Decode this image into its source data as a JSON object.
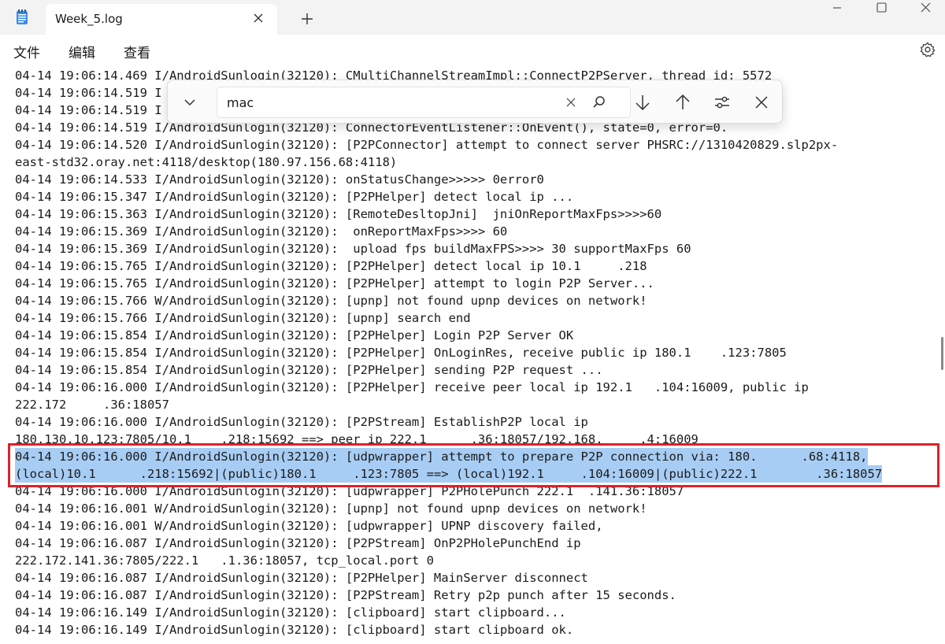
{
  "window": {
    "tab_title": "Week_5.log"
  },
  "menu": {
    "file": "文件",
    "edit": "编辑",
    "view": "查看"
  },
  "find": {
    "query": "mac"
  },
  "log_lines": [
    "04-14 19:06:14.469 I/AndroidSunlogin(32120): CMultiChannelStreamImpl::ConnectP2PServer, thread id: 5572",
    "04-14 19:06:14.519 I",
    "04-14 19:06:14.519 I",
    "04-14 19:06:14.519 I/AndroidSunlogin(32120): ConnectorEventListener::OnEvent(), state=0, error=0.",
    "04-14 19:06:14.520 I/AndroidSunlogin(32120): [P2PConnector] attempt to connect server PHSRC://1310420829.slp2px-",
    "east-std32.oray.net:4118/desktop(180.97.156.68:4118)",
    "04-14 19:06:14.533 I/AndroidSunlogin(32120): onStatusChange>>>>> 0error0",
    "04-14 19:06:15.347 I/AndroidSunlogin(32120): [P2PHelper] detect local ip ...",
    "04-14 19:06:15.363 I/AndroidSunlogin(32120): [RemoteDesltopJni]  jniOnReportMaxFps>>>>60",
    "04-14 19:06:15.369 I/AndroidSunlogin(32120):  onReportMaxFps>>>> 60",
    "04-14 19:06:15.369 I/AndroidSunlogin(32120):  upload fps buildMaxFPS>>>> 30 supportMaxFps 60",
    "04-14 19:06:15.765 I/AndroidSunlogin(32120): [P2PHelper] detect local ip 10.1     .218",
    "04-14 19:06:15.765 I/AndroidSunlogin(32120): [P2PHelper] attempt to login P2P Server...",
    "04-14 19:06:15.766 W/AndroidSunlogin(32120): [upnp] not found upnp devices on network!",
    "04-14 19:06:15.766 I/AndroidSunlogin(32120): [upnp] search end",
    "04-14 19:06:15.854 I/AndroidSunlogin(32120): [P2PHelper] Login P2P Server OK",
    "04-14 19:06:15.854 I/AndroidSunlogin(32120): [P2PHelper] OnLoginRes, receive public ip 180.1    .123:7805",
    "04-14 19:06:15.854 I/AndroidSunlogin(32120): [P2PHelper] sending P2P request ...",
    "04-14 19:06:16.000 I/AndroidSunlogin(32120): [P2PHelper] receive peer local ip 192.1   .104:16009, public ip",
    "222.172     .36:18057",
    "04-14 19:06:16.000 I/AndroidSunlogin(32120): [P2PStream] EstablishP2P local ip",
    "180.130.10.123:7805/10.1    .218:15692 ==> peer ip 222.1      .36:18057/192.168.     .4:16009",
    "04-14 19:06:16.000 I/AndroidSunlogin(32120): [udpwrapper] attempt to prepare P2P connection via: 180.      .68:4118,",
    "(local)10.1      .218:15692|(public)180.1     .123:7805 ==> (local)192.1     .104:16009|(public)222.1        .36:18057",
    "04-14 19:06:16.000 I/AndroidSunlogin(32120): [udpwrapper] P2PHolePunch 222.1  .141.36:18057",
    "04-14 19:06:16.001 W/AndroidSunlogin(32120): [upnp] not found upnp devices on network!",
    "04-14 19:06:16.001 W/AndroidSunlogin(32120): [udpwrapper] UPNP discovery failed,",
    "04-14 19:06:16.087 I/AndroidSunlogin(32120): [P2PStream] OnP2PHolePunchEnd ip",
    "222.172.141.36:7805/222.1   .1.36:18057, tcp_local.port 0",
    "04-14 19:06:16.087 I/AndroidSunlogin(32120): [P2PHelper] MainServer disconnect",
    "04-14 19:06:16.087 I/AndroidSunlogin(32120): [P2PStream] Retry p2p punch after 15 seconds.",
    "04-14 19:06:16.149 I/AndroidSunlogin(32120): [clipboard] start clipboard...",
    "04-14 19:06:16.149 I/AndroidSunlogin(32120): [clipboard] start clipboard ok."
  ],
  "colors": {
    "selection": "#a8cdf4",
    "highlight_border": "#e0202a",
    "titlebar_bg": "#f3f3f3"
  }
}
